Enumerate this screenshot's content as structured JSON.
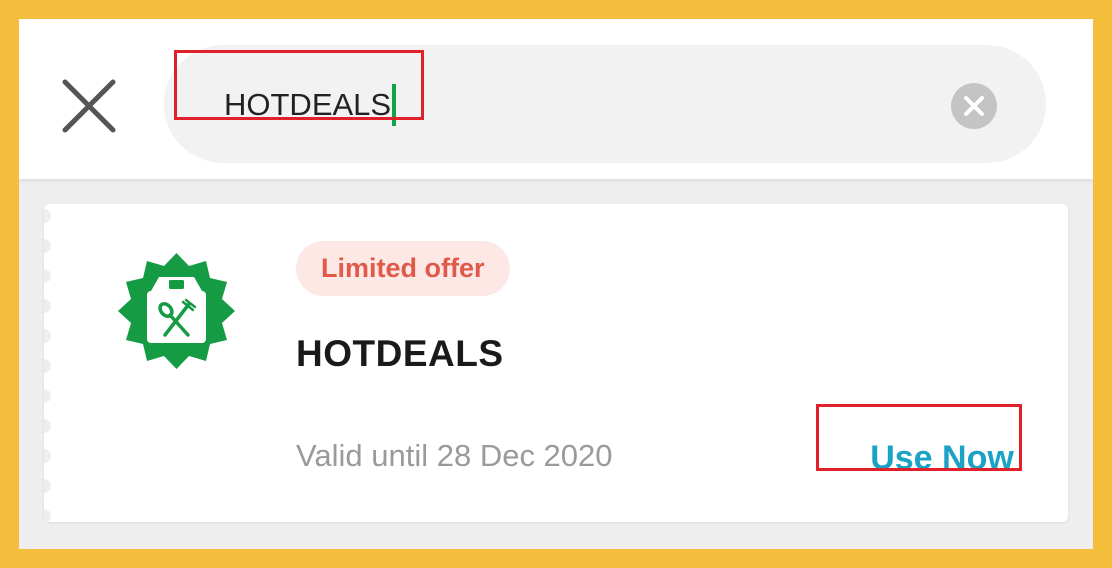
{
  "search": {
    "value": "HOTDEALS",
    "close_icon": "close-icon",
    "clear_icon": "clear-circle-icon"
  },
  "voucher": {
    "icon": "food-delivery-badge-icon",
    "tag": "Limited offer",
    "code": "HOTDEALS",
    "validity": "Valid until 28 Dec 2020",
    "action_label": "Use Now"
  },
  "colors": {
    "frame": "#f5bd3c",
    "brand_green": "#169b45",
    "tag_text": "#e05a4a",
    "tag_background": "#fde8e6",
    "action": "#1ba3c6",
    "highlight_outline": "#e0202a",
    "caret": "#12a24b"
  }
}
